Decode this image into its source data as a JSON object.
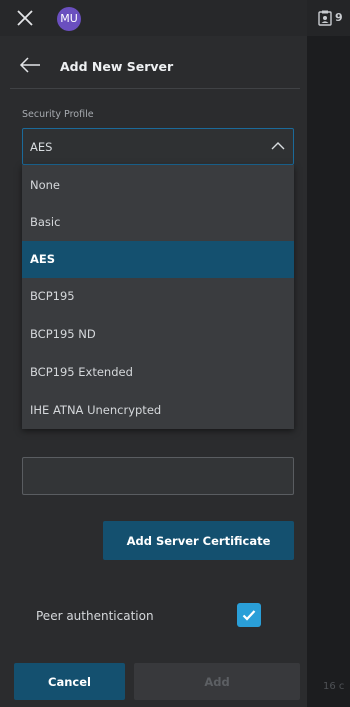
{
  "header": {
    "avatar_initials": "MU",
    "close_icon": "close-icon",
    "back_icon": "arrow-left-icon",
    "title": "Add New Server"
  },
  "security_profile": {
    "label": "Security Profile",
    "selected": "AES",
    "options": [
      "None",
      "Basic",
      "AES",
      "BCP195",
      "BCP195 ND",
      "BCP195 Extended",
      "IHE ATNA Unencrypted"
    ],
    "selected_index": 2
  },
  "server_input": {
    "value": "",
    "placeholder": ""
  },
  "buttons": {
    "add_certificate": "Add Server Certificate",
    "cancel": "Cancel",
    "add": "Add"
  },
  "peer_authentication": {
    "label": "Peer authentication",
    "checked": true
  },
  "background": {
    "count": "9",
    "footer_text": "16 c"
  },
  "colors": {
    "accent": "#14506f",
    "checkbox": "#2a9fd8",
    "avatar": "#6a4fbf",
    "panel": "#2b2c2e"
  }
}
